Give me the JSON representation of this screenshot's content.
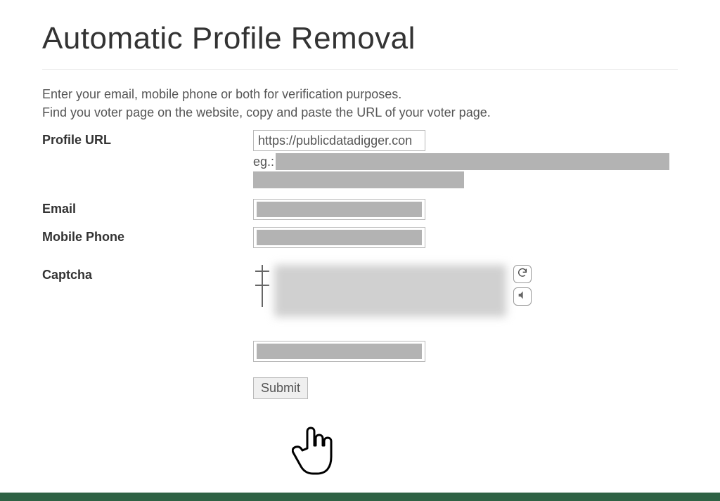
{
  "title": "Automatic Profile Removal",
  "intro_line1": "Enter your email, mobile phone or both for verification purposes.",
  "intro_line2": "Find you voter page on the website, copy and paste the URL of your voter page.",
  "labels": {
    "profile_url": "Profile URL",
    "email": "Email",
    "mobile": "Mobile Phone",
    "captcha": "Captcha"
  },
  "fields": {
    "profile_url_value": "https://publicdatadigger.con",
    "example_prefix": "eg.:",
    "submit": "Submit"
  }
}
